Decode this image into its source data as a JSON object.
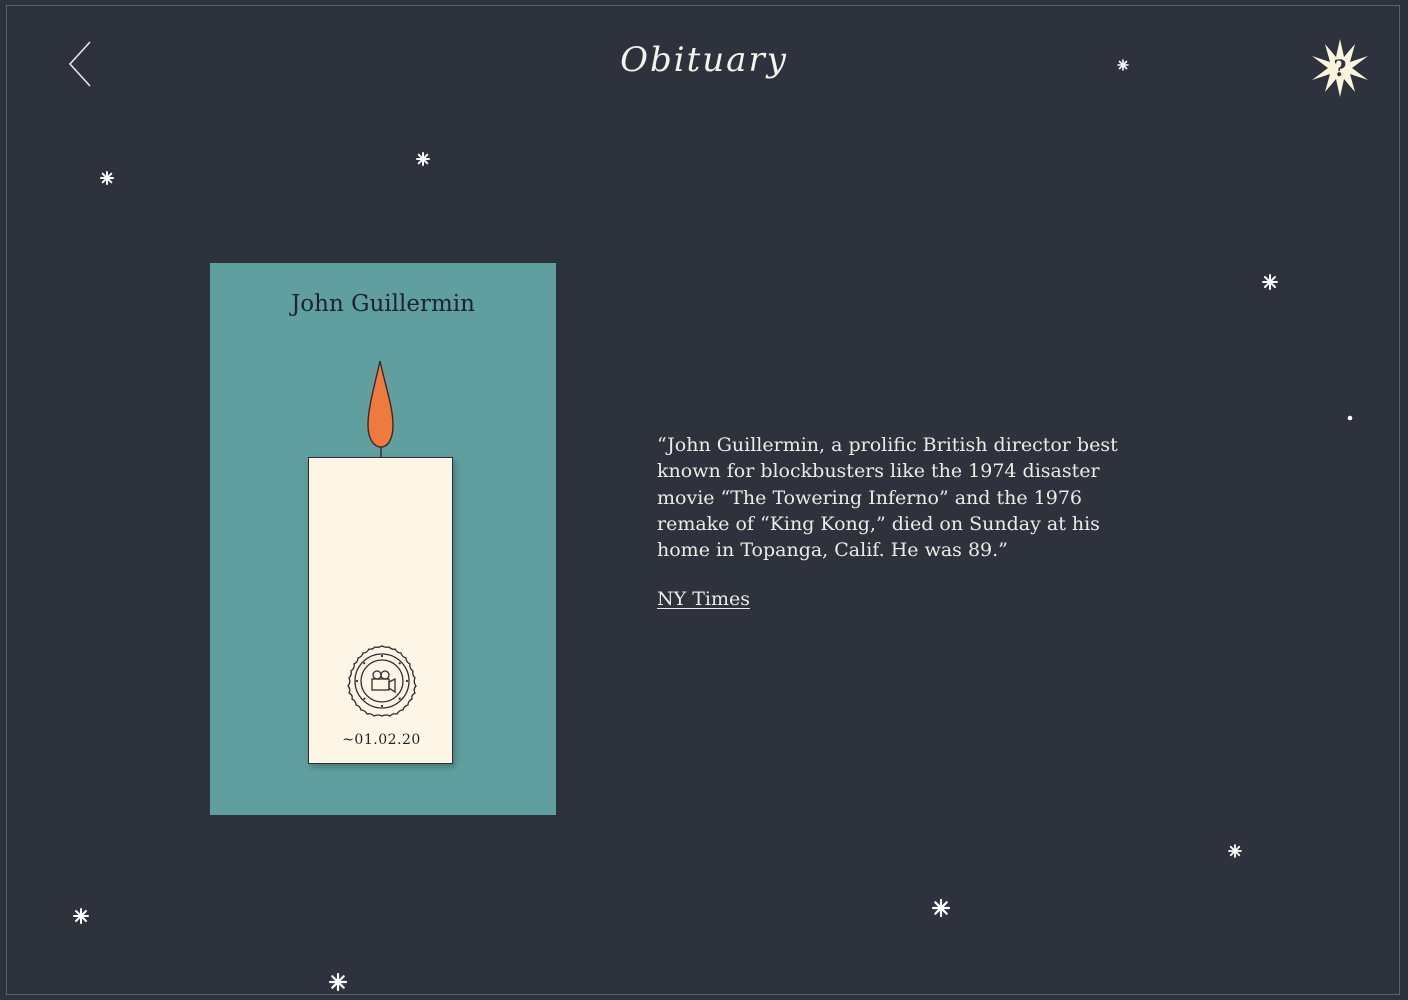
{
  "header": {
    "title": "Obituary",
    "back_icon": "chevron-left-icon",
    "help_icon": "star-question-icon",
    "help_symbol": "?"
  },
  "card": {
    "name": "John Guillermin",
    "date": "~01.02.20",
    "badge_icon": "film-camera-icon",
    "background_color": "#609fa0",
    "candle_color": "#fdf5e6",
    "flame_color": "#ef7a3e"
  },
  "obituary": {
    "quote": "“John Guillermin, a prolific British director best known for blockbusters like the 1974 disaster movie “The Towering Inferno” and the 1976 remake of “King Kong,” died on Sunday at his home in Topanga, Calif. He was 89.”",
    "source_label": "NY Times"
  },
  "theme": {
    "background": "#2e323d",
    "star_color": "#ffffff"
  }
}
